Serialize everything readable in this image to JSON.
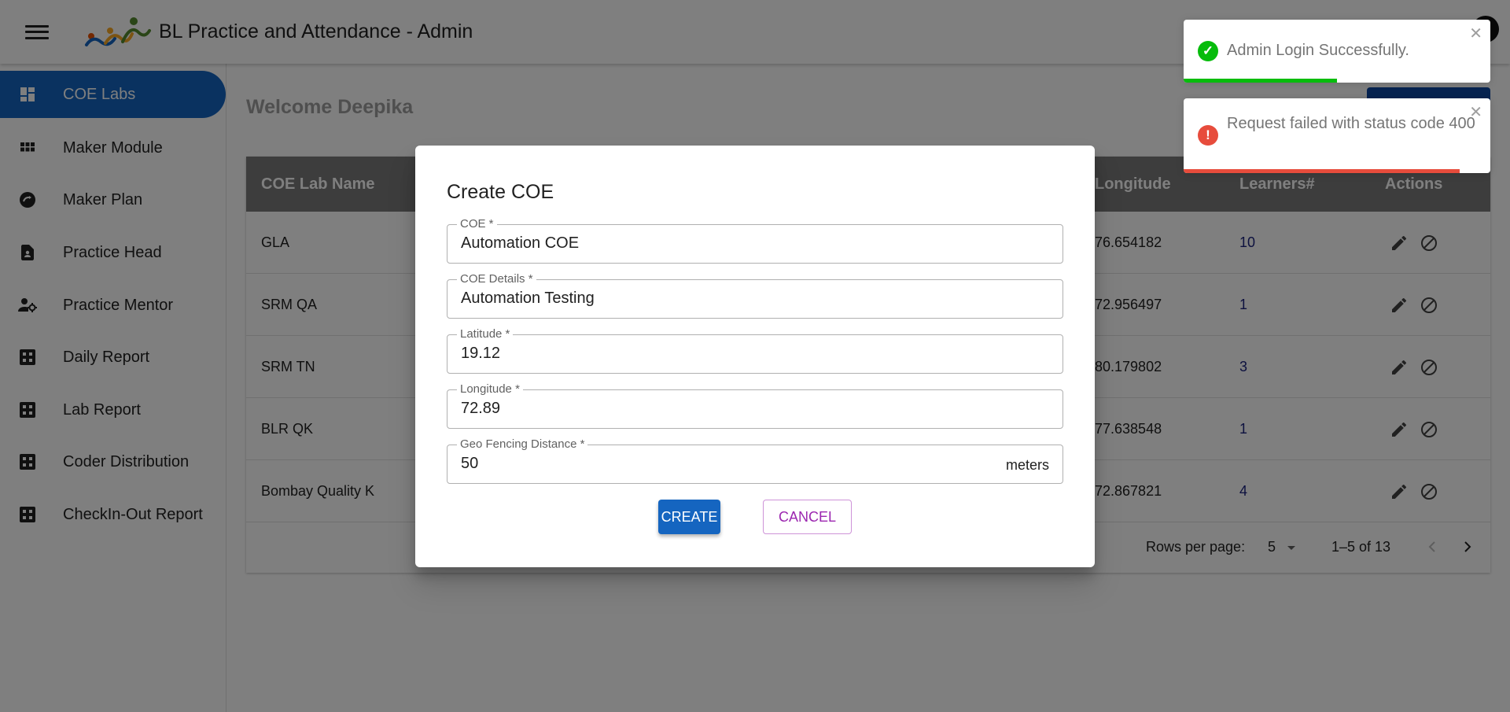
{
  "app": {
    "title": "BL Practice and Attendance - Admin"
  },
  "sidebar": {
    "items": [
      {
        "label": "COE Labs",
        "icon": "dashboard-icon",
        "active": true
      },
      {
        "label": "Maker Module",
        "icon": "grid-icon",
        "active": false
      },
      {
        "label": "Maker Plan",
        "icon": "speed-icon",
        "active": false
      },
      {
        "label": "Practice Head",
        "icon": "contact-page-icon",
        "active": false
      },
      {
        "label": "Practice Mentor",
        "icon": "manage-accounts-icon",
        "active": false
      },
      {
        "label": "Daily Report",
        "icon": "apps-box-icon",
        "active": false
      },
      {
        "label": "Lab Report",
        "icon": "apps-box-icon",
        "active": false
      },
      {
        "label": "Coder Distribution",
        "icon": "apps-box-icon",
        "active": false
      },
      {
        "label": "CheckIn-Out Report",
        "icon": "apps-box-icon",
        "active": false
      }
    ]
  },
  "main": {
    "welcome": "Welcome Deepika",
    "table": {
      "headers": {
        "name": "COE Lab Name",
        "longitude": "Longitude",
        "learners": "Learners#",
        "actions": "Actions"
      },
      "rows": [
        {
          "name": "GLA",
          "longitude": "76.654182",
          "learners": "10"
        },
        {
          "name": "SRM QA",
          "longitude": "72.956497",
          "learners": "1"
        },
        {
          "name": "SRM TN",
          "longitude": "80.179802",
          "learners": "3"
        },
        {
          "name": "BLR QK",
          "longitude": "77.638548",
          "learners": "1"
        },
        {
          "name": "Bombay Quality K",
          "longitude": "72.867821",
          "learners": "4"
        }
      ]
    },
    "pagination": {
      "rows_per_page_label": "Rows per page:",
      "rows_per_page": "5",
      "range": "1–5 of 13"
    }
  },
  "dialog": {
    "title": "Create COE",
    "fields": {
      "coe": {
        "label": "COE *",
        "value": "Automation COE"
      },
      "details": {
        "label": "COE Details *",
        "value": "Automation Testing"
      },
      "latitude": {
        "label": "Latitude *",
        "value": "19.12"
      },
      "longitude": {
        "label": "Longitude *",
        "value": "72.89"
      },
      "geofence": {
        "label": "Geo Fencing Distance *",
        "value": "50",
        "unit": "meters"
      }
    },
    "create_label": "CREATE",
    "cancel_label": "CANCEL"
  },
  "toasts": [
    {
      "type": "success",
      "message": "Admin Login Successfully.",
      "progress": 0.5,
      "color": "#07bc0c"
    },
    {
      "type": "error",
      "message": "Request failed with status code 400",
      "progress": 0.9,
      "color": "#e74c3c"
    }
  ],
  "colors": {
    "primary": "#1565c0",
    "secondary": "#9c27b0",
    "success": "#07bc0c",
    "error": "#e74c3c"
  }
}
